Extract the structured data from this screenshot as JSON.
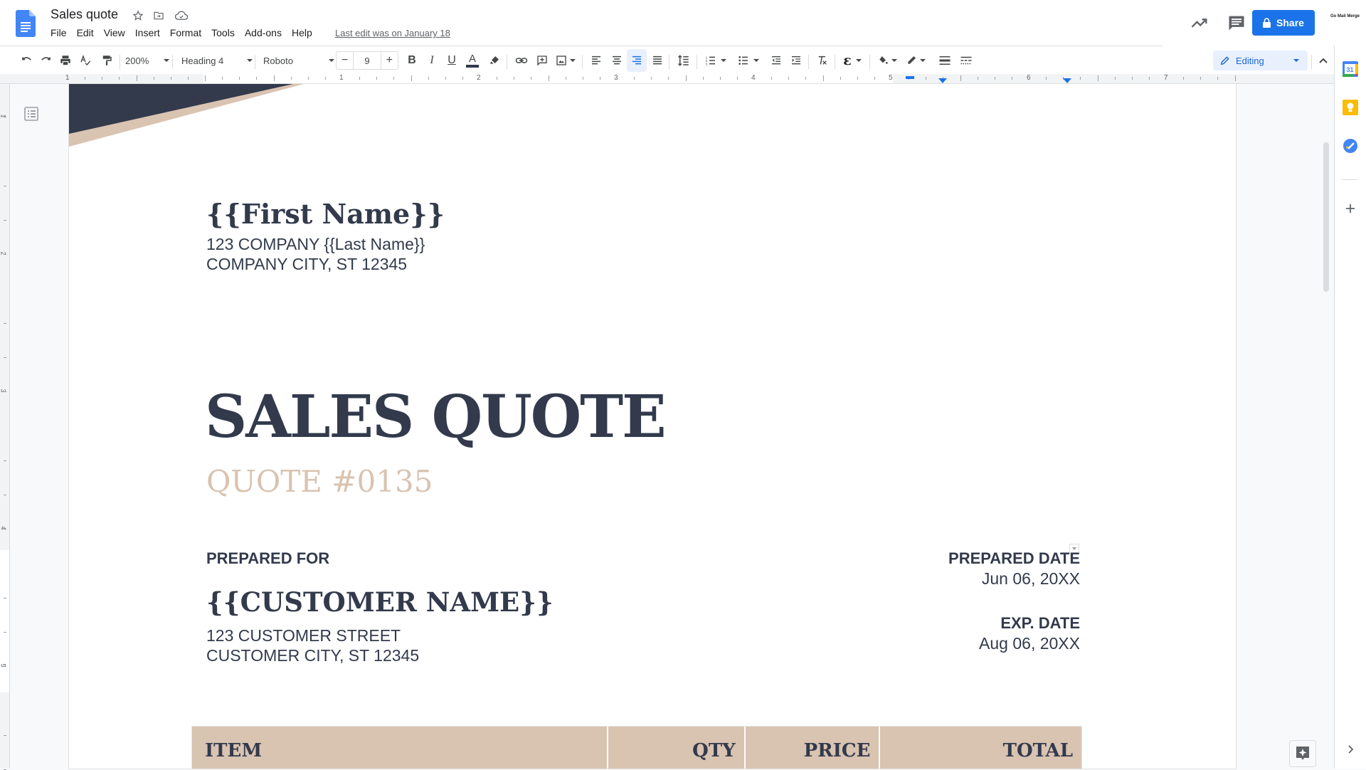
{
  "app": {
    "title": "Sales quote",
    "last_edit": "Last edit was on January 18",
    "menu": [
      "File",
      "Edit",
      "View",
      "Insert",
      "Format",
      "Tools",
      "Add-ons",
      "Help"
    ],
    "share_label": "Share",
    "addon_label": "Go Mail Merge"
  },
  "toolbar": {
    "zoom": "200%",
    "style": "Heading 4",
    "font": "Roboto",
    "font_size": "9",
    "size_minus": "−",
    "size_plus": "+",
    "mode": "Editing",
    "text_color": "#323a4c"
  },
  "ruler": {
    "horizontal_labels": [
      "1",
      "1",
      "2",
      "3",
      "4",
      "5",
      "6",
      "7"
    ],
    "vertical_labels": [
      "1",
      "2",
      "3",
      "4",
      "5"
    ]
  },
  "document": {
    "first_name": "{{First Name}}",
    "company_line1": "123 COMPANY {{Last Name}}",
    "company_line2": "COMPANY CITY, ST 12345",
    "title": "SALES QUOTE",
    "quote_number": "QUOTE #0135",
    "prepared_for_label": "PREPARED FOR",
    "customer_name": "{{CUSTOMER NAME}}",
    "customer_line1": "123 CUSTOMER STREET",
    "customer_line2": "CUSTOMER CITY, ST 12345",
    "prepared_date_label": "PREPARED DATE",
    "prepared_date": "Jun 06, 20XX",
    "exp_date_label": "EXP. DATE",
    "exp_date": "Aug 06, 20XX",
    "table_headers": [
      "ITEM",
      "QTY",
      "PRICE",
      "TOTAL"
    ]
  },
  "colors": {
    "accent_dark": "#323a4c",
    "accent_tan": "#d9c3b1",
    "brand_blue": "#1a73e8"
  }
}
